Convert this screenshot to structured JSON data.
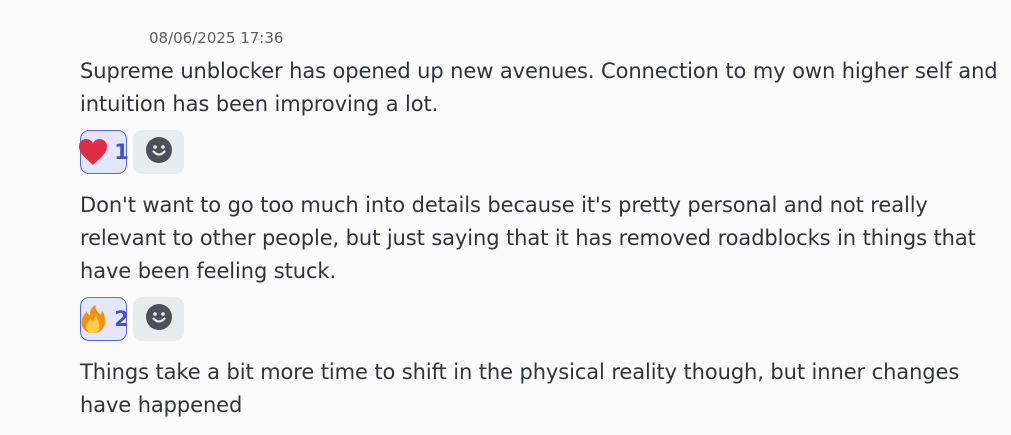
{
  "messages": [
    {
      "timestamp": "08/06/2025 17:36",
      "text": "Supreme unblocker has opened up new avenues. Connection to my own higher self and intuition has been improving a lot.",
      "reactions": [
        {
          "emoji": "heart-emoji",
          "count": "1",
          "selected": true
        }
      ]
    },
    {
      "text": "Don't want to go too much into details because it's pretty personal and not really relevant to other people, but just saying that it has removed roadblocks in things that have been feeling stuck.",
      "reactions": [
        {
          "emoji": "fire-emoji",
          "count": "2",
          "selected": true
        }
      ]
    },
    {
      "text": "Things take a bit more time to shift in the physical reality though, but inner changes have happened"
    }
  ],
  "icons": {
    "add_reaction": "smiley-add-icon"
  },
  "colors": {
    "accent": "#5865f2",
    "reaction_bg": "#e3e6fc",
    "reaction_count": "#4752c4",
    "text": "#313338",
    "background": "#fbfbfb"
  }
}
